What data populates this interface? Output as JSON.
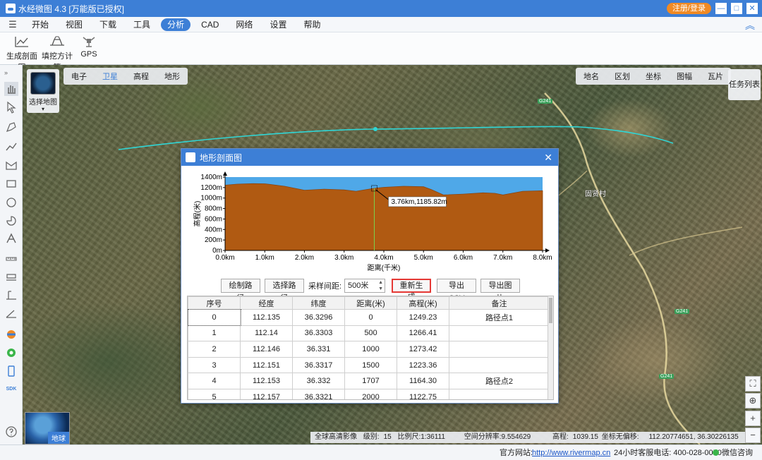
{
  "window": {
    "title": "水经微图 4.3 [万能版已授权]",
    "register_label": "注册/登录",
    "min_symbol": "—",
    "max_symbol": "□",
    "close_symbol": "✕"
  },
  "menu": {
    "hamburger": "☰",
    "items": [
      "开始",
      "视图",
      "下载",
      "工具",
      "分析",
      "CAD",
      "网络",
      "设置",
      "帮助"
    ],
    "active_index": 4,
    "collapse_symbol": "︽"
  },
  "ribbon": {
    "buttons": [
      {
        "label": "生成剖面图",
        "icon": "chart-line-icon"
      },
      {
        "label": "填挖方计算",
        "icon": "excavation-icon"
      },
      {
        "label": "GPS",
        "icon": "satellite-icon"
      }
    ]
  },
  "map": {
    "select_map_label": "选择地图",
    "select_map_caret": "▾",
    "base_tabs": [
      "电子",
      "卫星",
      "高程",
      "地形"
    ],
    "base_active_index": 1,
    "layer_tabs": [
      "地名",
      "区划",
      "坐标",
      "图幅",
      "瓦片"
    ],
    "task_list": "任务列表",
    "globe_label": "地球",
    "village_label": "固贤村",
    "road_badge": "G241",
    "status": {
      "source": "全球高清影像",
      "level_label": "级别:",
      "level": "15",
      "scale_label": "比例尺:",
      "scale": "1:36111",
      "resolution_label": "空间分辨率:",
      "resolution": "9.554629",
      "elevation_label": "高程:",
      "elevation": "1039.15",
      "coord_label": "坐标无偏移:",
      "coord": "112.20774651, 36.30226135"
    },
    "right_tools": [
      "⛶",
      "⊕",
      "+",
      "−"
    ]
  },
  "statusbar": {
    "site_label": "官方网站:",
    "site_url": "http://www.rivermap.cn",
    "hotline": "24小时客服电话: 400-028-0050",
    "wechat": "微信咨询"
  },
  "dialog": {
    "title": "地形剖面图",
    "close_symbol": "✕",
    "buttons": {
      "draw_path": "绘制路径",
      "select_path": "选择路径",
      "regenerate": "重新生成",
      "export_csv": "导出CSV",
      "export_image": "导出图片"
    },
    "sample_label": "采样间距:",
    "sample_value": "500米",
    "spin_up": "▲",
    "spin_down": "▼",
    "table": {
      "headers": [
        "序号",
        "经度",
        "纬度",
        "距离(米)",
        "高程(米)",
        "备注"
      ],
      "rows": [
        [
          "0",
          "112.135",
          "36.3296",
          "0",
          "1249.23",
          "路径点1"
        ],
        [
          "1",
          "112.14",
          "36.3303",
          "500",
          "1266.41",
          ""
        ],
        [
          "2",
          "112.146",
          "36.331",
          "1000",
          "1273.42",
          ""
        ],
        [
          "3",
          "112.151",
          "36.3317",
          "1500",
          "1223.36",
          ""
        ],
        [
          "4",
          "112.153",
          "36.332",
          "1707",
          "1164.30",
          "路径点2"
        ],
        [
          "5",
          "112.157",
          "36.3321",
          "2000",
          "1122.75",
          ""
        ]
      ]
    }
  },
  "chart_data": {
    "type": "area",
    "xlabel": "距离(千米)",
    "ylabel": "高程(米)",
    "xlim": [
      0,
      8
    ],
    "ylim": [
      0,
      1400
    ],
    "x_ticks": [
      "0.0km",
      "1.0km",
      "2.0km",
      "3.0km",
      "4.0km",
      "5.0km",
      "6.0km",
      "7.0km",
      "8.0km"
    ],
    "y_ticks": [
      "0m",
      "200m",
      "400m",
      "600m",
      "800m",
      "1000m",
      "1200m",
      "1400m"
    ],
    "fill_color": "#b05a12",
    "sky_color": "#4fa8e8",
    "series": [
      {
        "x": [
          0,
          0.3,
          0.7,
          1.0,
          1.5,
          2.0,
          2.5,
          3.0,
          3.3,
          3.76,
          4.0,
          4.5,
          5.0,
          5.2,
          5.5,
          6.0,
          6.5,
          6.8,
          7.0,
          7.5,
          8.0
        ],
        "y": [
          1245,
          1265,
          1275,
          1272,
          1225,
          1150,
          1170,
          1155,
          1130,
          1186,
          1205,
          1225,
          1215,
          1160,
          1060,
          1075,
          1100,
          1090,
          1060,
          1130,
          1140
        ]
      }
    ],
    "marker": {
      "x": 3.76,
      "y": 1185.82,
      "label": "3.76km,1185.82m"
    }
  }
}
